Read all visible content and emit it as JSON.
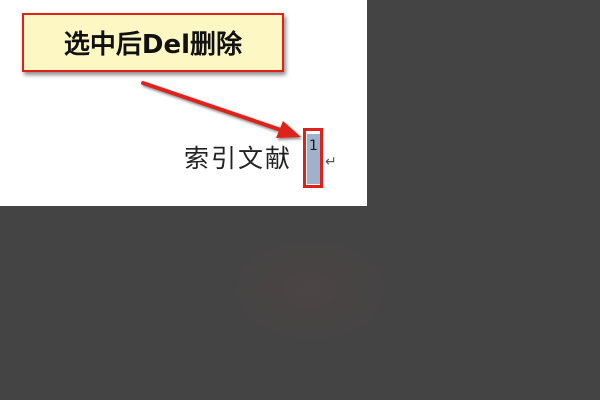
{
  "callout": {
    "text": "选中后Del删除"
  },
  "document": {
    "text": "索引文献",
    "footnote_mark": "1",
    "paragraph_mark": "↵"
  },
  "colors": {
    "callout_bg": "#fdf7c4",
    "annotation_red": "#e0211a",
    "selection": "#9fb2cc",
    "background": "#444444"
  },
  "icons": {
    "arrow": "red-arrow-icon"
  }
}
